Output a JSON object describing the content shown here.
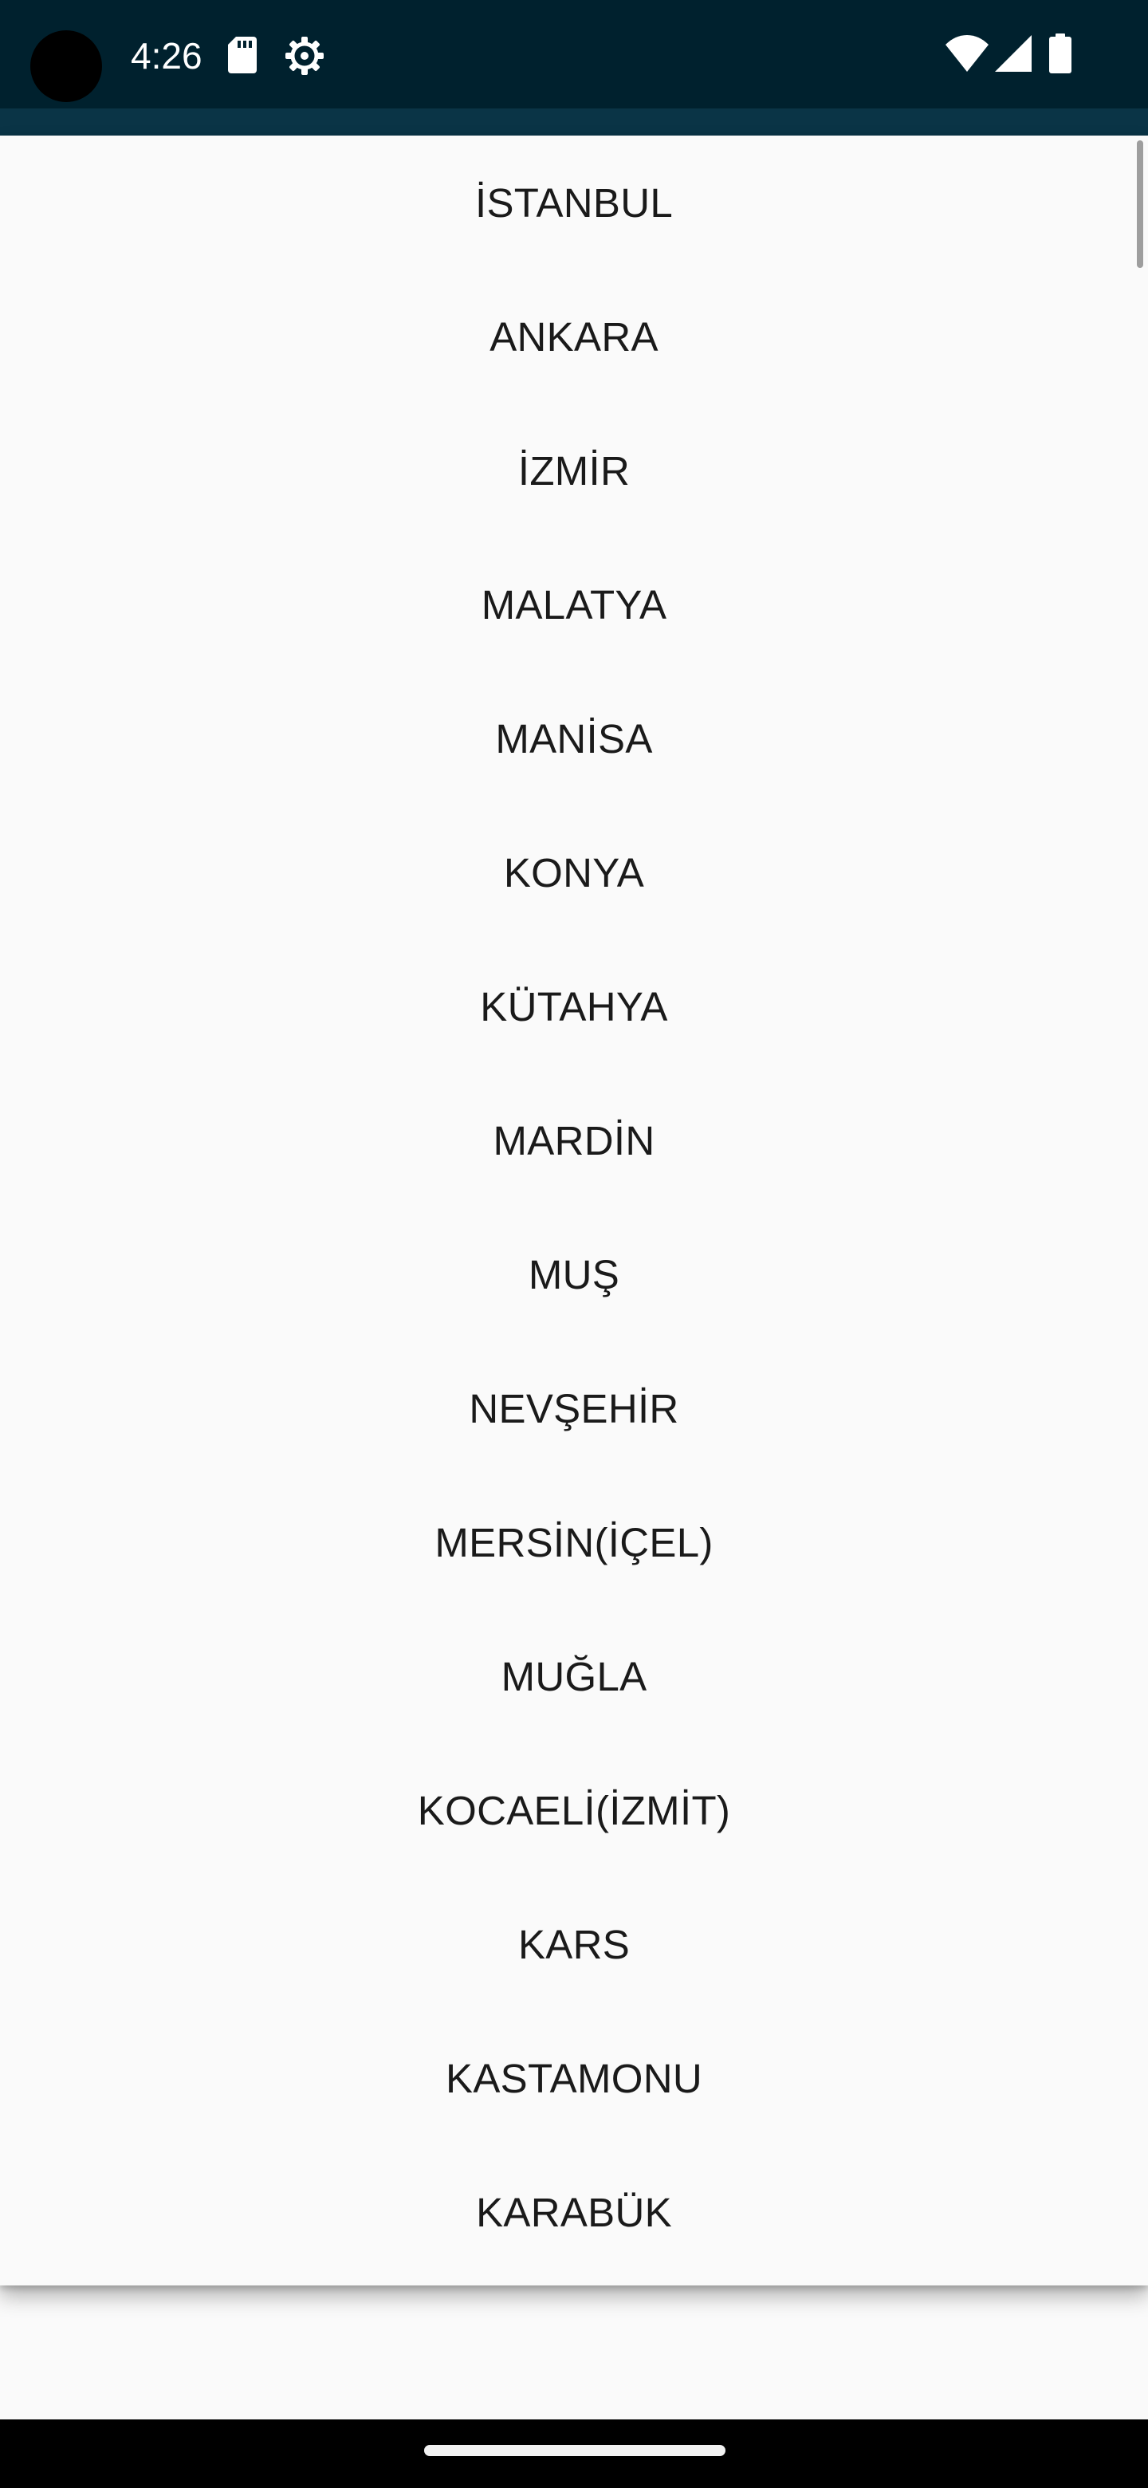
{
  "status_bar": {
    "time": "4:26",
    "left_icons": [
      "sd-card-icon",
      "settings-gear-icon"
    ],
    "right_icons": [
      "wifi-icon",
      "cell-signal-icon",
      "battery-icon"
    ],
    "background": "#00212e"
  },
  "dropdown": {
    "items": [
      {
        "label": "İSTANBUL"
      },
      {
        "label": "ANKARA"
      },
      {
        "label": "İZMİR"
      },
      {
        "label": "MALATYA"
      },
      {
        "label": "MANİSA"
      },
      {
        "label": "KONYA"
      },
      {
        "label": "KÜTAHYA"
      },
      {
        "label": "MARDİN"
      },
      {
        "label": "MUŞ"
      },
      {
        "label": "NEVŞEHİR"
      },
      {
        "label": "MERSİN(İÇEL)"
      },
      {
        "label": "MUĞLA"
      },
      {
        "label": "KOCAELİ(İZMİT)"
      },
      {
        "label": "KARS"
      },
      {
        "label": "KASTAMONU"
      },
      {
        "label": "KARABÜK"
      }
    ],
    "text_color": "#1a1a1a",
    "background": "#fafafa"
  },
  "navigation": {
    "gesture_handle": "home-gesture-handle"
  }
}
